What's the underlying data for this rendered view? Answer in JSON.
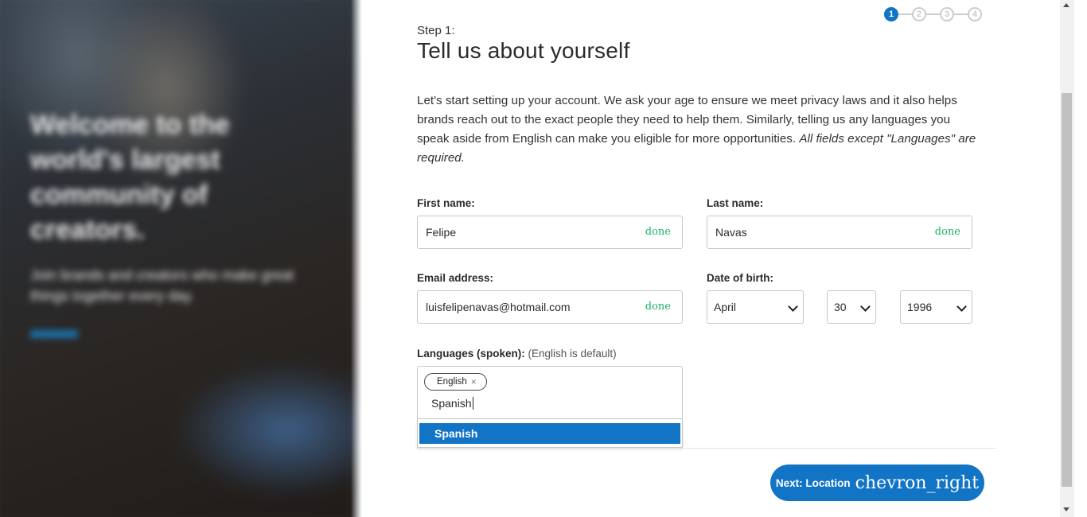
{
  "stepper": {
    "steps": [
      "1",
      "2",
      "3",
      "4"
    ],
    "active": 1
  },
  "heading": {
    "step_label": "Step 1:",
    "title": "Tell us about yourself"
  },
  "intro": {
    "text": "Let's start setting up your account. We ask your age to ensure we meet privacy laws and it also helps brands reach out to the exact people they need to help them. Similarly, telling us any languages you speak aside from English can make you eligible for more opportunities.",
    "emphasis": "All fields except \"Languages\" are required."
  },
  "form": {
    "first_name": {
      "label": "First name:",
      "value": "Felipe",
      "status": "done"
    },
    "last_name": {
      "label": "Last name:",
      "value": "Navas",
      "status": "done"
    },
    "email": {
      "label": "Email address:",
      "value": "luisfelipenavas@hotmail.com",
      "status": "done"
    },
    "dob": {
      "label": "Date of birth:",
      "month": "April",
      "day": "30",
      "year": "1996"
    },
    "languages": {
      "label": "Languages (spoken):",
      "hint": "(English is default)",
      "tags": [
        "English"
      ],
      "tag_remove": "×",
      "input_value": "Spanish",
      "suggestions": [
        "Spanish"
      ]
    }
  },
  "next_button": {
    "label": "Next: Location",
    "icon": "chevron_right"
  },
  "colors": {
    "accent": "#1174c5",
    "done": "#1bb36a"
  }
}
